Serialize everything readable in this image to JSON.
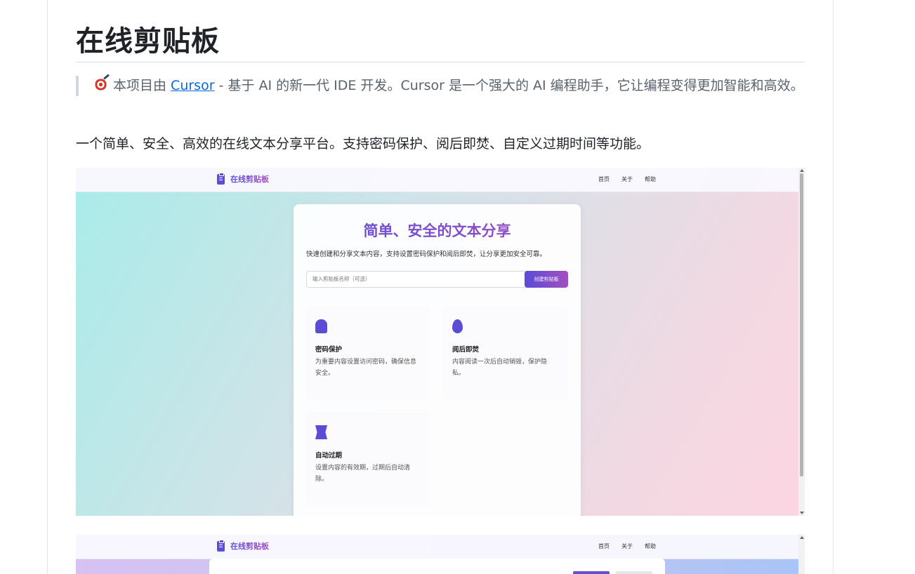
{
  "readme": {
    "title": "在线剪贴板",
    "quote": {
      "icon": "target-dart-icon",
      "prefix": "本项目由 ",
      "link_text": "Cursor",
      "suffix": " - 基于 AI 的新一代 IDE 开发。Cursor 是一个强大的 AI 编程助手，它让编程变得更加智能和高效。"
    },
    "description": "一个简单、安全、高效的在线文本分享平台。支持密码保护、阅后即焚、自定义过期时间等功能。"
  },
  "screenshot1": {
    "nav": {
      "logo_icon": "clipboard-icon",
      "logo_text": "在线剪贴板",
      "links": [
        "首页",
        "关于",
        "帮助"
      ]
    },
    "hero": {
      "title": "简单、安全的文本分享",
      "subtitle": "快速创建和分享文本内容，支持设置密码保护和阅后即焚，让分享更加安全可靠。",
      "input_placeholder": "输入剪贴板名称（可选）",
      "create_button": "创建剪贴板"
    },
    "features": [
      {
        "icon": "lock-icon",
        "title": "密码保护",
        "desc": "为重要内容设置访问密码，确保信息安全。"
      },
      {
        "icon": "fire-icon",
        "title": "阅后即焚",
        "desc": "内容阅读一次后自动销毁，保护隐私。"
      },
      {
        "icon": "hourglass-icon",
        "title": "自动过期",
        "desc": "设置内容的有效期，过期后自动清除。"
      }
    ]
  },
  "screenshot2": {
    "nav": {
      "logo_icon": "clipboard-icon",
      "logo_text": "在线剪贴板",
      "links": [
        "首页",
        "关于",
        "帮助"
      ]
    }
  },
  "colors": {
    "accent_start": "#5b4cd6",
    "accent_end": "#a24fc0",
    "link": "#0969da"
  }
}
